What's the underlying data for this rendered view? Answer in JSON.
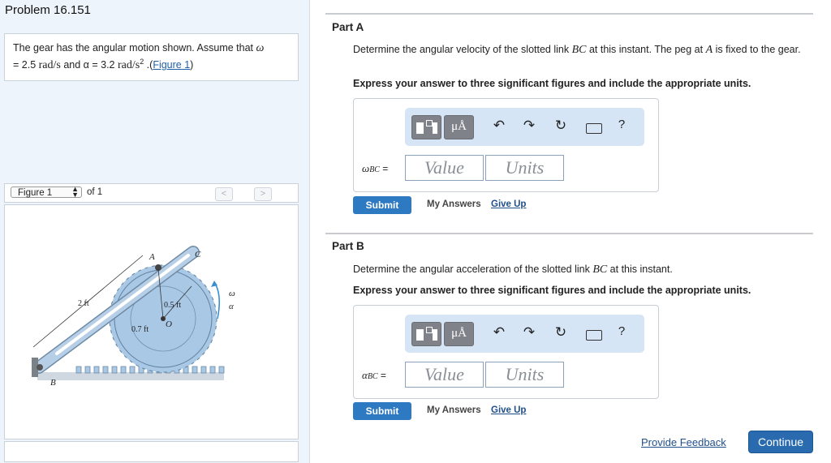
{
  "left": {
    "title": "Problem 16.151",
    "problem": {
      "text_a": "The gear has the angular motion shown. Assume that ",
      "omega_sym": "ω",
      "text_b": "= 2.5 ",
      "unit_rads": "rad/s",
      "text_c": " and α = 3.2 ",
      "unit_rads2": "rad/s",
      "sup2": "2",
      "text_d": " .(",
      "fig_link": "Figure 1",
      "text_e": ")"
    },
    "figure_bar": {
      "select_value": "Figure 1",
      "of_text": "of 1",
      "prev": "<",
      "next": ">"
    },
    "figure": {
      "label_A": "A",
      "label_B": "B",
      "label_C": "C",
      "label_O": "O",
      "label_omega": "ω",
      "label_alpha": "α",
      "dim_2ft": "2 ft",
      "dim_05ft": "0.5 ft",
      "dim_07ft": "0.7 ft"
    }
  },
  "partA": {
    "title": "Part A",
    "question_a": "Determine the angular velocity of the slotted link ",
    "question_var": "BC",
    "question_b": " at this instant. The peg at ",
    "question_var2": "A",
    "question_c": " is fixed to the gear.",
    "instruction": "Express your answer to three significant figures and include the appropriate units.",
    "var_main": "ω",
    "var_sub": "BC",
    "eq": "=",
    "value_placeholder": "Value",
    "units_placeholder": "Units",
    "submit": "Submit",
    "my_answers": "My Answers",
    "give_up": "Give Up"
  },
  "partB": {
    "title": "Part B",
    "question_a": "Determine the angular acceleration of the slotted link ",
    "question_var": "BC",
    "question_b": " at this instant.",
    "instruction": "Express your answer to three significant figures and include the appropriate units.",
    "var_main": "α",
    "var_sub": "BC",
    "eq": "=",
    "value_placeholder": "Value",
    "units_placeholder": "Units",
    "submit": "Submit",
    "my_answers": "My Answers",
    "give_up": "Give Up"
  },
  "toolbar": {
    "units_glyph": "μÅ",
    "help_glyph": "?"
  },
  "footer": {
    "feedback": "Provide Feedback",
    "continue": "Continue"
  },
  "colors": {
    "accent": "#2d79c2",
    "toolbar_bg": "#d5e5f6",
    "gear": "#a9c8e6",
    "link": "#8fb2d4"
  }
}
